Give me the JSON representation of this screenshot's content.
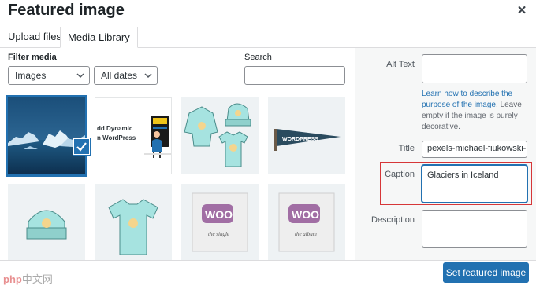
{
  "modal": {
    "title": "Featured image",
    "close_label": "×"
  },
  "tabs": [
    {
      "label": "Upload files",
      "active": false
    },
    {
      "label": "Media Library",
      "active": true
    }
  ],
  "filters": {
    "label": "Filter media",
    "type_value": "Images",
    "date_value": "All dates",
    "search_label": "Search",
    "search_value": ""
  },
  "attachments": [
    {
      "name": "glacier-photo",
      "selected": true
    },
    {
      "name": "add-dynamic-content-in-wordpress",
      "text_line1": "dd Dynamic",
      "text_line2": "n WordPress"
    },
    {
      "name": "hoodie-and-beanie"
    },
    {
      "name": "wordpress-pennant",
      "text": "WORDPRESS"
    },
    {
      "name": "beanie"
    },
    {
      "name": "t-shirt"
    },
    {
      "name": "woo-single",
      "text": "WOO",
      "subtext": "the single"
    },
    {
      "name": "woo-album",
      "text": "WOO",
      "subtext": "the album"
    }
  ],
  "details": {
    "alt_text_label": "Alt Text",
    "alt_text_value": "",
    "help_link": "Learn how to describe the purpose of the image",
    "help_rest": ". Leave empty if the image is purely decorative.",
    "title_label": "Title",
    "title_value": "pexels-michael-fiukowski-",
    "caption_label": "Caption",
    "caption_value": "Glaciers in Iceland",
    "description_label": "Description",
    "description_value": ""
  },
  "footer": {
    "set_button": "Set featured image"
  },
  "watermark": {
    "brand": "php",
    "text": "中文网"
  },
  "colors": {
    "accent": "#2271b1",
    "highlight": "#d63638"
  }
}
